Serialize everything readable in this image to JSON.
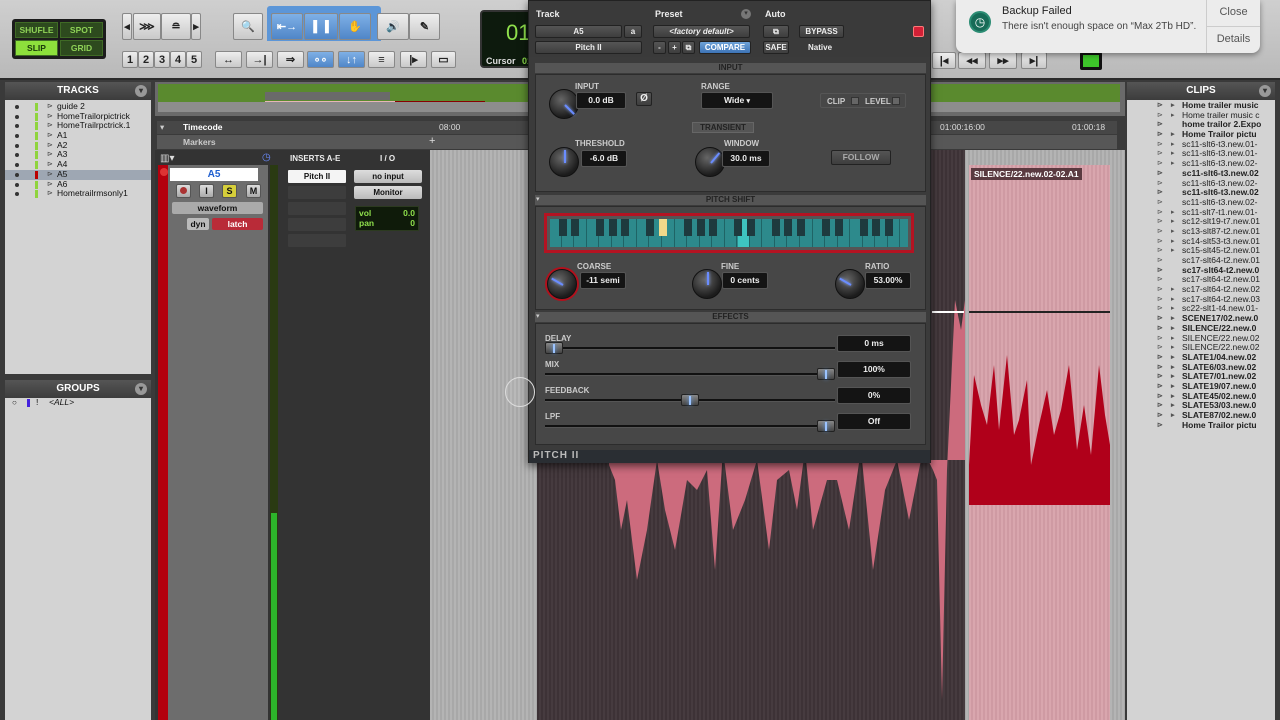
{
  "toolbar": {
    "edit_modes": [
      {
        "label": "SHUFLE",
        "active": false
      },
      {
        "label": "SPOT",
        "active": false
      },
      {
        "label": "SLIP",
        "active": true
      },
      {
        "label": "GRID",
        "active": false
      }
    ],
    "zoom_presets": [
      "1",
      "2",
      "3",
      "4",
      "5"
    ],
    "counter": {
      "main": "01",
      "label": "Cursor",
      "value": "01"
    }
  },
  "notification": {
    "title": "Backup Failed",
    "message": "There isn't enough space on “Max 2Tb HD”.",
    "close_label": "Close",
    "details_label": "Details"
  },
  "tracks_pane": {
    "title": "TRACKS",
    "items": [
      {
        "name": "guide 2",
        "selected": false
      },
      {
        "name": "HomeTrailorpictrick",
        "selected": false
      },
      {
        "name": "HomeTrailrpctrick.1",
        "selected": false
      },
      {
        "name": "A1",
        "selected": false
      },
      {
        "name": "A2",
        "selected": false
      },
      {
        "name": "A3",
        "selected": false
      },
      {
        "name": "A4",
        "selected": false
      },
      {
        "name": "A5",
        "selected": true
      },
      {
        "name": "A6",
        "selected": false
      },
      {
        "name": "Hometrailrmsonly1",
        "selected": false
      }
    ]
  },
  "groups_pane": {
    "title": "GROUPS",
    "items": [
      "<ALL>"
    ]
  },
  "rulers": {
    "timecode": "Timecode",
    "markers": "Markers",
    "tc1": "08:00",
    "tc2": "01:00:16:00",
    "tc3": "01:00:18"
  },
  "mix_strip": {
    "track_name": "A5",
    "inserts_header": "INSERTS A-E",
    "io_header": "I / O",
    "insert_1": "Pitch II",
    "input": "no input",
    "monitor": "Monitor",
    "view": "waveform",
    "dyn": "dyn",
    "automation": "latch",
    "vol_label": "vol",
    "vol_value": "0.0",
    "pan_label": "pan",
    "pan_value": "0",
    "buttons": [
      "I",
      "S",
      "M"
    ]
  },
  "plugin": {
    "track_label": "Track",
    "preset_label": "Preset",
    "auto_label": "Auto",
    "track_value": "A5",
    "channel": "a",
    "plugin_name": "Pitch II",
    "preset_value": "<factory default>",
    "minus": "-",
    "plus": "+",
    "compare": "COMPARE",
    "bypass": "BYPASS",
    "safe": "SAFE",
    "native": "Native",
    "footer": "PITCH II",
    "input_section": {
      "title": "INPUT",
      "input_label": "INPUT",
      "input_value": "0.0 dB",
      "phase_symbol": "Ø",
      "range_label": "RANGE",
      "range_value": "Wide",
      "clip_label": "CLIP",
      "level_label": "LEVEL",
      "transient_title": "TRANSIENT",
      "threshold_label": "THRESHOLD",
      "threshold_value": "-6.0 dB",
      "window_label": "WINDOW",
      "window_value": "30.0 ms",
      "follow_label": "FOLLOW"
    },
    "pitch_section": {
      "title": "PITCH SHIFT",
      "coarse_label": "COARSE",
      "coarse_value": "-11 semi",
      "fine_label": "FINE",
      "fine_value": "0 cents",
      "ratio_label": "RATIO",
      "ratio_value": "53.00%"
    },
    "effects_section": {
      "title": "EFFECTS",
      "sliders": [
        {
          "label": "DELAY",
          "value": "0 ms",
          "position": 0.0
        },
        {
          "label": "MIX",
          "value": "100%",
          "position": 1.0
        },
        {
          "label": "FEEDBACK",
          "value": "0%",
          "position": 0.5
        },
        {
          "label": "LPF",
          "value": "Off",
          "position": 1.0
        }
      ]
    }
  },
  "edit": {
    "clip_name": "SILENCE/22.new.02-02.A1"
  },
  "clips_pane": {
    "title": "CLIPS",
    "items": [
      {
        "name": "Home trailer music",
        "bold": true,
        "arrow": true
      },
      {
        "name": "Home trailer music c",
        "bold": false,
        "arrow": true
      },
      {
        "name": "home trailor 2.Expo",
        "bold": true,
        "arrow": false
      },
      {
        "name": "Home Trailor pictu",
        "bold": true,
        "arrow": true
      },
      {
        "name": "sc11-slt6-t3.new.01-",
        "bold": false,
        "arrow": true
      },
      {
        "name": "sc11-slt6-t3.new.01-",
        "bold": false,
        "arrow": true
      },
      {
        "name": "sc11-slt6-t3.new.02-",
        "bold": false,
        "arrow": true
      },
      {
        "name": "sc11-slt6-t3.new.02",
        "bold": true,
        "arrow": false
      },
      {
        "name": "sc11-slt6-t3.new.02-",
        "bold": false,
        "arrow": false
      },
      {
        "name": "sc11-slt6-t3.new.02",
        "bold": true,
        "arrow": false
      },
      {
        "name": "sc11-slt6-t3.new.02-",
        "bold": false,
        "arrow": false
      },
      {
        "name": "sc11-slt7-t1.new.01-",
        "bold": false,
        "arrow": true
      },
      {
        "name": "sc12-slt19-t7.new.01",
        "bold": false,
        "arrow": true
      },
      {
        "name": "sc13-slt87-t2.new.01",
        "bold": false,
        "arrow": true
      },
      {
        "name": "sc14-slt53-t3.new.01",
        "bold": false,
        "arrow": true
      },
      {
        "name": "sc15-slt45-t2.new.01",
        "bold": false,
        "arrow": true
      },
      {
        "name": "sc17-slt64-t2.new.01",
        "bold": false,
        "arrow": false
      },
      {
        "name": "sc17-slt64-t2.new.0",
        "bold": true,
        "arrow": false
      },
      {
        "name": "sc17-slt64-t2.new.01",
        "bold": false,
        "arrow": false
      },
      {
        "name": "sc17-slt64-t2.new.02",
        "bold": false,
        "arrow": true
      },
      {
        "name": "sc17-slt64-t2.new.03",
        "bold": false,
        "arrow": true
      },
      {
        "name": "sc22-slt1-t4.new.01-",
        "bold": false,
        "arrow": true
      },
      {
        "name": "SCENE17/02.new.0",
        "bold": true,
        "arrow": true
      },
      {
        "name": "SILENCE/22.new.0",
        "bold": true,
        "arrow": true
      },
      {
        "name": "SILENCE/22.new.02",
        "bold": false,
        "arrow": true
      },
      {
        "name": "SILENCE/22.new.02",
        "bold": false,
        "arrow": true
      },
      {
        "name": "SLATE1/04.new.02",
        "bold": true,
        "arrow": true
      },
      {
        "name": "SLATE6/03.new.02",
        "bold": true,
        "arrow": true
      },
      {
        "name": "SLATE7/01.new.02",
        "bold": true,
        "arrow": true
      },
      {
        "name": "SLATE19/07.new.0",
        "bold": true,
        "arrow": true
      },
      {
        "name": "SLATE45/02.new.0",
        "bold": true,
        "arrow": true
      },
      {
        "name": "SLATE53/03.new.0",
        "bold": true,
        "arrow": true
      },
      {
        "name": "SLATE87/02.new.0",
        "bold": true,
        "arrow": true
      },
      {
        "name": "Home Trailor pictu",
        "bold": true,
        "arrow": false
      }
    ]
  }
}
